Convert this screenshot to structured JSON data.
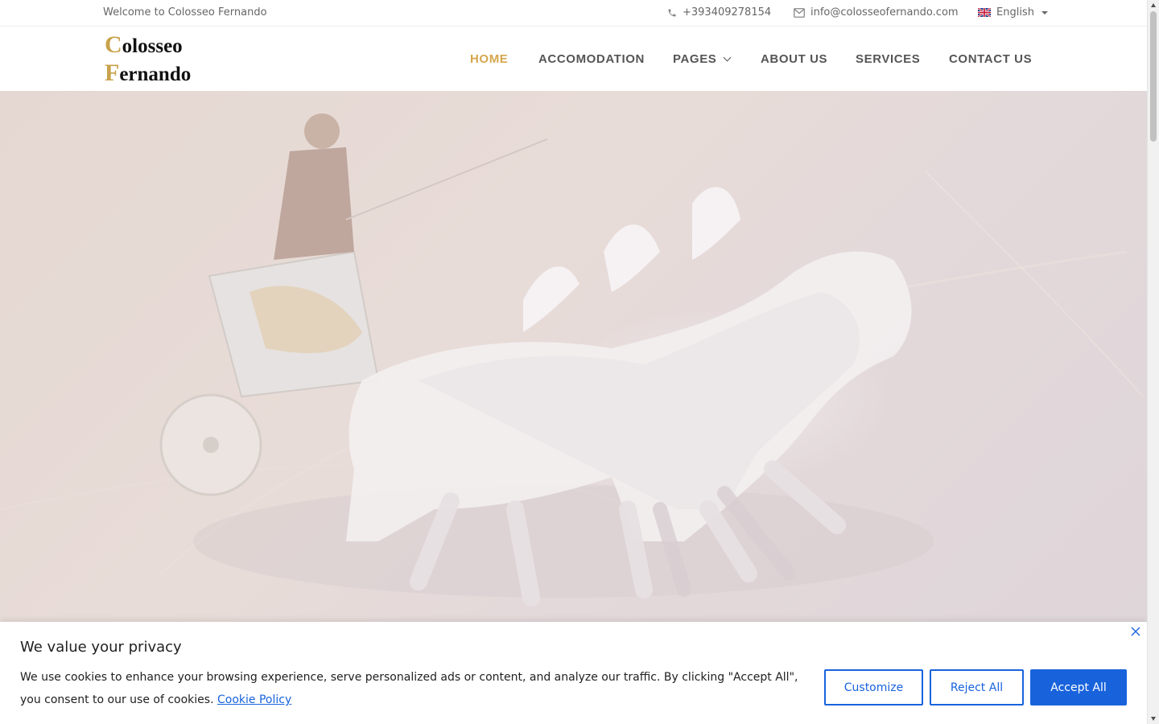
{
  "topbar": {
    "welcome": "Welcome to Colosseo Fernando",
    "phone": "+393409278154",
    "email": "info@colosseofernando.com",
    "language": "English"
  },
  "logo": {
    "line1_cap": "C",
    "line1_rest": "olosseo",
    "line2_cap": "F",
    "line2_rest": "ernando"
  },
  "nav": {
    "items": [
      {
        "label": "HOME",
        "active": true
      },
      {
        "label": "ACCOMODATION",
        "active": false
      },
      {
        "label": "PAGES",
        "active": false,
        "has_dropdown": true
      },
      {
        "label": "ABOUT US",
        "active": false
      },
      {
        "label": "SERVICES",
        "active": false
      },
      {
        "label": "CONTACT US",
        "active": false
      }
    ]
  },
  "cookie": {
    "title": "We value your privacy",
    "message": "We use cookies to enhance your browsing experience, serve personalized ads or content, and analyze our traffic. By clicking \"Accept All\", you consent to our use of cookies.",
    "policy_link": "Cookie Policy",
    "customize": "Customize",
    "reject": "Reject All",
    "accept": "Accept All"
  },
  "colors": {
    "accent": "#d4a74c",
    "cookie_blue": "#1863dc",
    "nav_text": "#555555"
  },
  "icons": {
    "phone": "phone-icon",
    "email": "envelope-icon",
    "flag": "uk-flag-icon",
    "close": "close-icon",
    "chevron": "chevron-down-icon"
  }
}
